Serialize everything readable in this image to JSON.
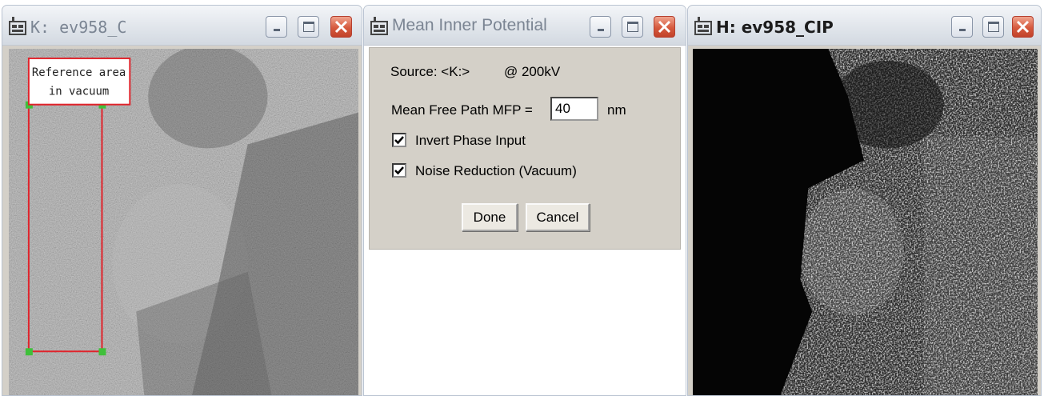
{
  "windows": {
    "left": {
      "title": "K: ev958_C",
      "roi_annotation": {
        "line1": "Reference area",
        "line2": "in vacuum"
      }
    },
    "dialog": {
      "title": "Mean Inner Potential",
      "source_label": "Source: <K:>",
      "voltage_label": "@ 200kV",
      "mfp_label": "Mean Free Path MFP =",
      "mfp_value": "40",
      "mfp_unit": "nm",
      "invert_phase_label": "Invert Phase Input",
      "invert_phase_checked": true,
      "noise_reduction_label": "Noise Reduction (Vacuum)",
      "noise_reduction_checked": true,
      "done_label": "Done",
      "cancel_label": "Cancel"
    },
    "right": {
      "title": "H: ev958_CIP"
    }
  },
  "colors": {
    "roi_border": "#e0232b",
    "roi_handle": "#3fc03a",
    "close_button": "#d65a3e"
  },
  "icons": [
    "app-icon",
    "minimize-icon",
    "maximize-icon",
    "close-icon",
    "checkmark-icon"
  ]
}
